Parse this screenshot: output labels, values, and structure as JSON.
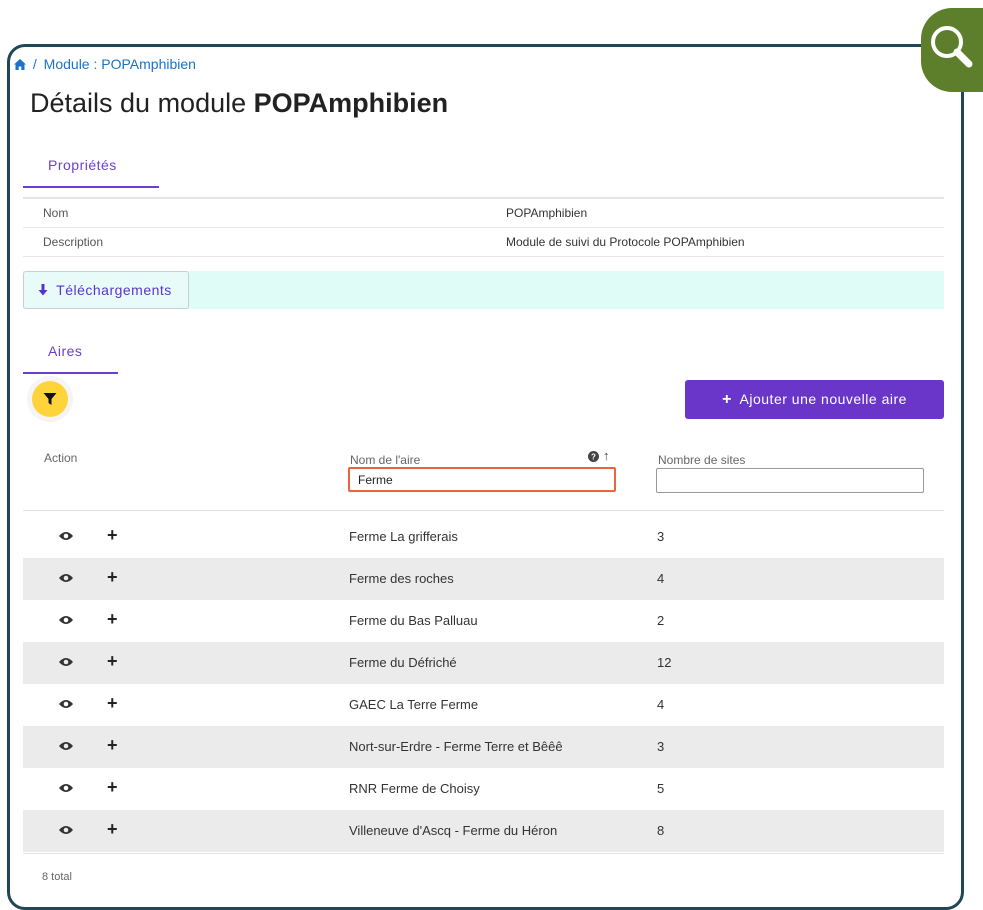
{
  "breadcrumb": {
    "home_icon": "home-icon",
    "separator": "/",
    "current": "Module : POPAmphibien"
  },
  "page": {
    "title_prefix": "Détails du module",
    "title_name": "POPAmphibien"
  },
  "properties_tab": {
    "label": "Propriétés"
  },
  "properties": [
    {
      "key": "Nom",
      "value": "POPAmphibien"
    },
    {
      "key": "Description",
      "value": "Module de suivi du Protocole POPAmphibien"
    }
  ],
  "downloads": {
    "icon": "arrow-down-icon",
    "label": "Téléchargements"
  },
  "areas_tab": {
    "label": "Aires"
  },
  "toolbar": {
    "filter_icon": "filter-icon",
    "add_label": "Ajouter une nouvelle aire",
    "add_icon": "plus-icon"
  },
  "table": {
    "columns": {
      "action": "Action",
      "name": "Nom de l'aire",
      "sites": "Nombre de sites"
    },
    "name_filter_value": "Ferme",
    "sites_filter_value": "",
    "sort_icons": [
      "help-icon",
      "sort-arrow-up-icon"
    ],
    "rows": [
      {
        "name": "Ferme La grifferais",
        "sites": "3"
      },
      {
        "name": "Ferme des roches",
        "sites": "4"
      },
      {
        "name": "Ferme du Bas Palluau",
        "sites": "2"
      },
      {
        "name": "Ferme du Défriché",
        "sites": "12"
      },
      {
        "name": "GAEC La Terre Ferme",
        "sites": "4"
      },
      {
        "name": "Nort-sur-Erdre - Ferme Terre et Bêêê",
        "sites": "3"
      },
      {
        "name": "RNR Ferme de Choisy",
        "sites": "5"
      },
      {
        "name": "Villeneuve d'Ascq - Ferme du Héron",
        "sites": "8"
      }
    ],
    "total": "8 total"
  },
  "colors": {
    "accent": "#6a36c9",
    "link": "#1a73c9",
    "fab": "#ffd43b",
    "frame": "#1f4757",
    "badge": "#5d7f2b",
    "download_bar": "#dffcf7",
    "filter_border": "#e8663c"
  }
}
